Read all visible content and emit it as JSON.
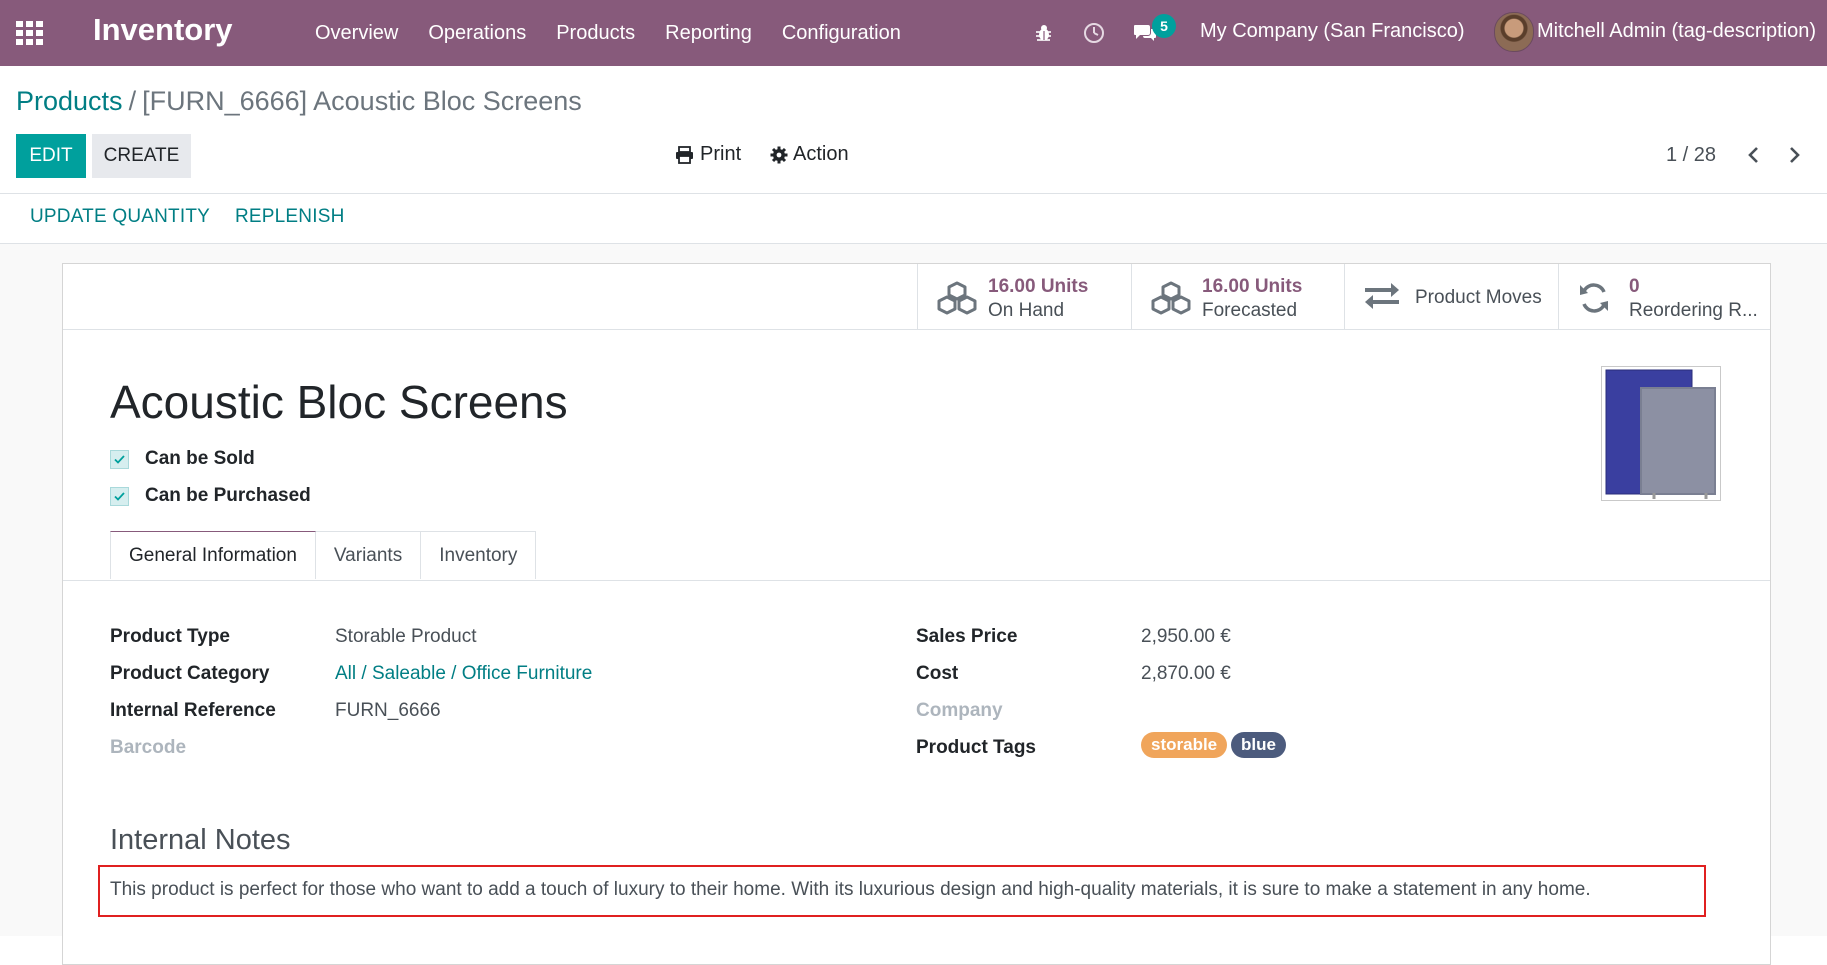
{
  "navbar": {
    "app_name": "Inventory",
    "menu": [
      "Overview",
      "Operations",
      "Products",
      "Reporting",
      "Configuration"
    ],
    "message_count": "5",
    "company": "My Company (San Francisco)",
    "user": "Mitchell Admin (tag-description)",
    "background_color": "#875a7b",
    "icons": [
      "apps-grid-icon",
      "bug-icon",
      "clock-icon",
      "chat-icon"
    ]
  },
  "breadcrumb": {
    "parent": "Products",
    "separator": "/",
    "current": "[FURN_6666] Acoustic Bloc Screens"
  },
  "toolbar": {
    "edit": "EDIT",
    "create": "CREATE",
    "print": "Print",
    "action": "Action",
    "pager": "1 / 28"
  },
  "statusbar": {
    "update_quantity": "UPDATE QUANTITY",
    "replenish": "REPLENISH"
  },
  "smart_buttons": {
    "on_hand_value": "16.00 Units",
    "on_hand_label": "On Hand",
    "forecast_value": "16.00 Units",
    "forecast_label": "Forecasted",
    "moves_label": "Product Moves",
    "reorder_value": "0",
    "reorder_label": "Reordering R..."
  },
  "product": {
    "name": "Acoustic Bloc Screens",
    "can_be_sold": "Can be Sold",
    "can_be_purchased": "Can be Purchased"
  },
  "tabs": [
    "General Information",
    "Variants",
    "Inventory"
  ],
  "fields": {
    "product_type_label": "Product Type",
    "product_type_value": "Storable Product",
    "category_label": "Product Category",
    "category_value": "All / Saleable / Office Furniture",
    "internal_ref_label": "Internal Reference",
    "internal_ref_value": "FURN_6666",
    "barcode_label": "Barcode",
    "sales_price_label": "Sales Price",
    "sales_price_value": "2,950.00 €",
    "cost_label": "Cost",
    "cost_value": "2,870.00 €",
    "company_label": "Company",
    "tags_label": "Product Tags",
    "tags": [
      {
        "label": "storable",
        "color": "#f0a55b"
      },
      {
        "label": "blue",
        "color": "#4c5b7d"
      }
    ]
  },
  "notes": {
    "title": "Internal Notes",
    "text": "This product is perfect for those who want to add a touch of luxury to their home. With its luxurious design and high-quality materials, it is sure to make a statement in any home."
  },
  "colors": {
    "primary": "#00a09d",
    "link": "#017e84",
    "accent": "#875a7b",
    "highlight_box": "#e02020"
  }
}
